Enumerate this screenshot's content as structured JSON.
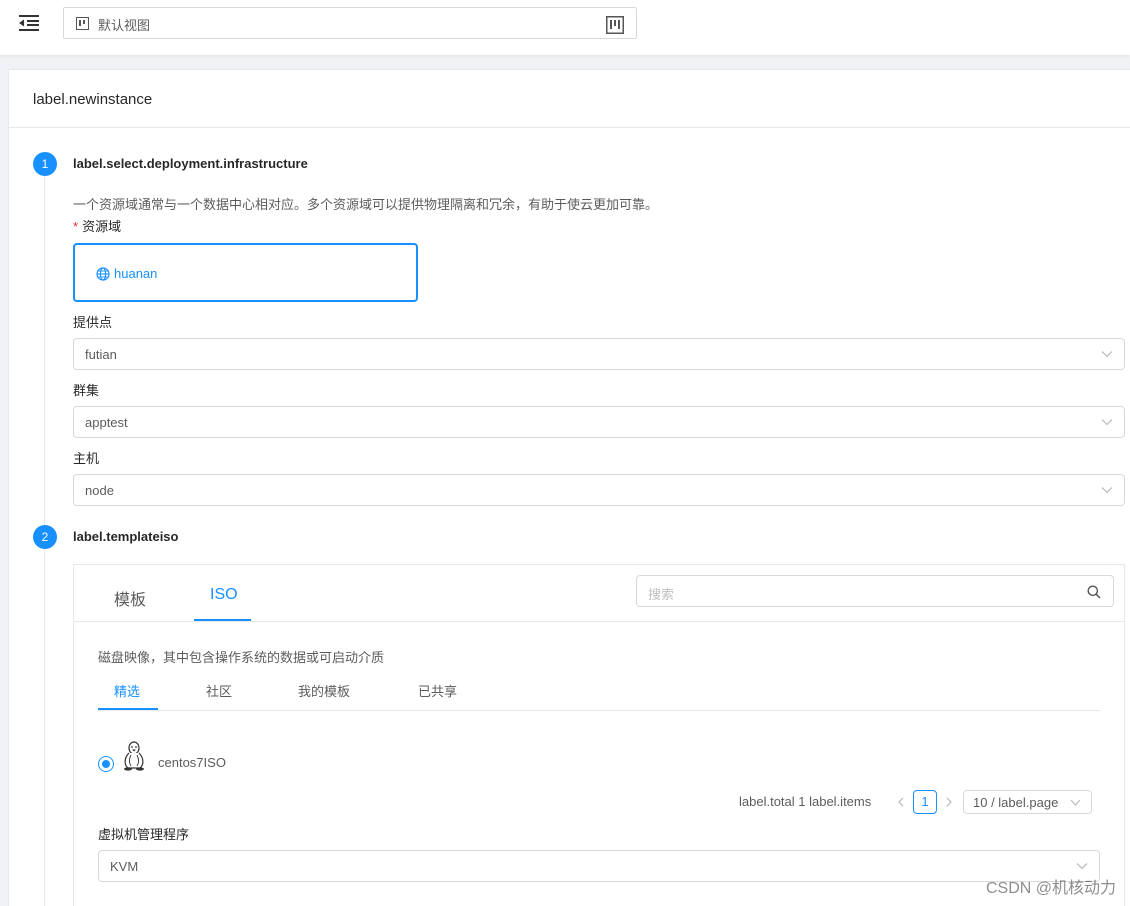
{
  "topbar": {
    "view_label": "默认视图"
  },
  "card": {
    "title": "label.newinstance"
  },
  "step1": {
    "number": "1",
    "title": "label.select.deployment.infrastructure",
    "description": "一个资源域通常与一个数据中心相对应。多个资源域可以提供物理隔离和冗余，有助于使云更加可靠。",
    "zone_label": "资源域",
    "zone_required": "*",
    "zone_name": "huanan",
    "pod_label": "提供点",
    "pod_value": "futian",
    "cluster_label": "群集",
    "cluster_value": "apptest",
    "host_label": "主机",
    "host_value": "node"
  },
  "step2": {
    "number": "2",
    "title": "label.templateiso",
    "tabs": [
      "模板",
      "ISO"
    ],
    "active_tab": "ISO",
    "search_placeholder": "搜索",
    "description": "磁盘映像，其中包含操作系统的数据或可启动介质",
    "subtabs": [
      "精选",
      "社区",
      "我的模板",
      "已共享"
    ],
    "active_subtab": "精选",
    "iso_item": {
      "name": "centos7ISO",
      "selected": true,
      "icon": "linux-tux-icon"
    },
    "pagination": {
      "total_text": "label.total 1 label.items",
      "current_page": "1",
      "page_size": "10 / label.page"
    },
    "hypervisor_label": "虚拟机管理程序",
    "hypervisor_value": "KVM"
  },
  "watermark": "CSDN @机核动力",
  "colors": {
    "primary": "#1890ff",
    "required": "#f5222d",
    "border": "#d9d9d9",
    "background": "#f0f2f5"
  }
}
